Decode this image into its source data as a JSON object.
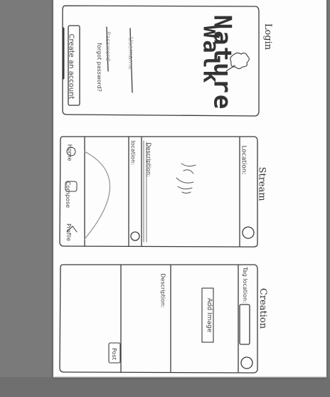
{
  "screens": {
    "login": {
      "title": "Login",
      "app_name_line1": "Nature",
      "app_name_line2": "Walk",
      "username_placeholder": "Username",
      "password_placeholder": "Password",
      "forgot_password": "forgot password?",
      "create_account": "Create an account"
    },
    "stream": {
      "title": "Stream",
      "location_header": "Location:",
      "description_label": "Description:",
      "location_label": "location:",
      "nav_home": "Home",
      "nav_compose": "Compose",
      "nav_profile": "Profile"
    },
    "creation": {
      "title": "Creation",
      "tag_location": "Tag location:",
      "add_image": "Add Image",
      "description_label": "Description:",
      "post_button": "Post"
    }
  }
}
